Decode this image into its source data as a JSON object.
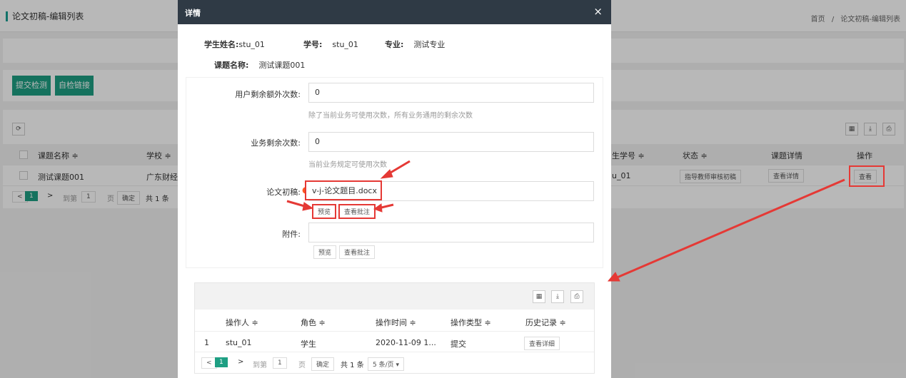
{
  "page": {
    "title": "论文初稿-编辑列表",
    "breadcrumb": [
      "首页",
      "/",
      "论文初稿-编辑列表"
    ],
    "buttons": {
      "submit": "提交检测",
      "link": "自检链接"
    },
    "table": {
      "headers": [
        "课题名称",
        "学校",
        "生学号",
        "状态",
        "课题详情",
        "操作"
      ],
      "row": {
        "topic": "测试课题001",
        "school": "广东财经",
        "student_no": "u_01",
        "status": "指导教师审核初稿",
        "detail": "查看详情",
        "action": "查看"
      },
      "pager": {
        "prev": "<",
        "page": "1",
        "next": ">",
        "goto": "到第",
        "page_input": "1",
        "page_unit": "页",
        "confirm": "确定",
        "total": "共 1 条"
      }
    }
  },
  "modal": {
    "title": "详情",
    "close": "×",
    "student_name_label": "学生姓名:",
    "student_name": "stu_01",
    "student_id_label": "学号:",
    "student_id": "stu_01",
    "major_label": "专业:",
    "major": "测试专业",
    "topic_label": "课题名称:",
    "topic": "测试课题001",
    "extra_label": "用户剩余额外次数:",
    "extra_value": "0",
    "extra_hint": "除了当前业务可使用次数，所有业务通用的剩余次数",
    "biz_label": "业务剩余次数:",
    "biz_value": "0",
    "biz_hint": "当前业务规定可使用次数",
    "draft_label": "论文初稿:",
    "draft_value": "v-j-论文题目.docx",
    "preview": "预览",
    "view_comments": "查看批注",
    "attach_label": "附件:",
    "attach_value": "",
    "attach_preview": "预览",
    "attach_comments": "查看批注",
    "log": {
      "headers": [
        "操作人",
        "角色",
        "操作时间",
        "操作类型",
        "历史记录"
      ],
      "row": {
        "no": "1",
        "operator": "stu_01",
        "role": "学生",
        "time": "2020-11-09 1...",
        "type": "提交",
        "history": "查看详细"
      },
      "pager": {
        "prev": "<",
        "page": "1",
        "next": ">",
        "goto": "到第",
        "page_input": "1",
        "page_unit": "页",
        "confirm": "确定",
        "total": "共 1 条",
        "size": "5 条/页 ▾"
      }
    }
  },
  "colors": {
    "accent": "#1e9f83",
    "modal_header": "#2f3a45",
    "annotation": "#e53935",
    "required": "#ff5722"
  }
}
